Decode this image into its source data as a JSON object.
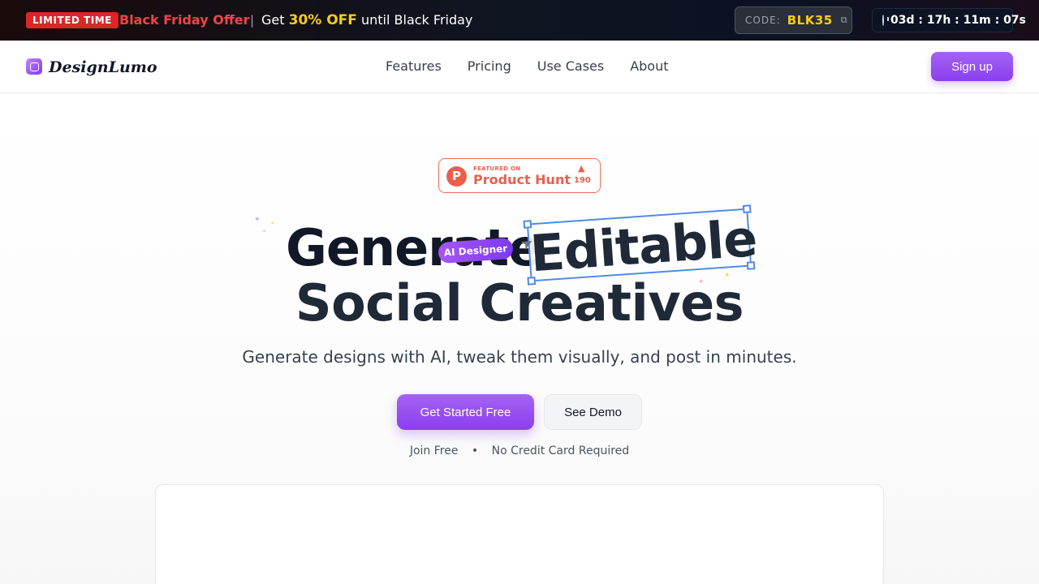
{
  "promo": {
    "badge": "LIMITED TIME",
    "offer": "Black Friday Offer",
    "separator": "|",
    "msg_prefix": "Get",
    "msg_highlight": "30% OFF",
    "msg_suffix": "until Black Friday",
    "code_label": "CODE:",
    "code_value": "BLK35",
    "countdown": "03d : 17h : 11m : 07s"
  },
  "nav": {
    "logo": "DesignLumo",
    "links": [
      "Features",
      "Pricing",
      "Use Cases",
      "About"
    ],
    "signup": "Sign up"
  },
  "hero": {
    "product_hunt": {
      "featured_on": "FEATURED ON",
      "name": "Product Hunt",
      "upvotes": "190"
    },
    "headline_part1": "Generate",
    "headline_editable": "Editable",
    "headline_line2": "Social Creatives",
    "ai_pill": "AI Designer",
    "subtitle": "Generate designs with AI, tweak them visually, and post in minutes.",
    "cta_primary": "Get Started Free",
    "cta_secondary": "See Demo",
    "note_left": "Join Free",
    "note_sep": "•",
    "note_right": "No Credit Card Required"
  },
  "colors": {
    "accent": "#8b3ff0",
    "promo_red": "#dc2626",
    "promo_yellow": "#facc15",
    "product_hunt": "#ea5f4c",
    "selection_blue": "#4f8be8"
  }
}
